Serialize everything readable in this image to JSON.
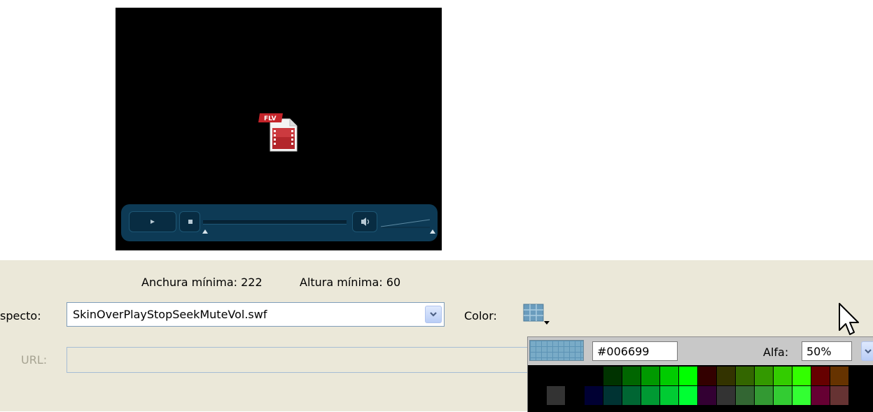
{
  "panel": {
    "min_width": "Anchura mínima: 222",
    "min_height": "Altura mínima: 60",
    "skin_label": "specto:",
    "skin_value": "SkinOverPlayStopSeekMuteVol.swf",
    "color_label": "Color:",
    "url_label": "URL:",
    "url_value": ""
  },
  "preview": {
    "badge_text": "FLV"
  },
  "picker": {
    "hex_value": "#006699",
    "alpha_label": "Alfa:",
    "alpha_value": "50%",
    "swatch_rows": [
      [
        "#000000",
        "#000000",
        "#000000",
        "#000000",
        "#003300",
        "#006600",
        "#009900",
        "#00cc00",
        "#00ff00",
        "#330000",
        "#333300",
        "#336600",
        "#339900",
        "#33cc00",
        "#33ff00",
        "#660000",
        "#663300"
      ],
      [
        "#000000",
        "#333333",
        "#000000",
        "#000033",
        "#003333",
        "#006633",
        "#009933",
        "#00cc33",
        "#00ff33",
        "#330033",
        "#333333",
        "#336633",
        "#339933",
        "#33cc33",
        "#33ff33",
        "#660033",
        "#663333"
      ]
    ]
  },
  "colors": {
    "panel_bg": "#ebe8d9",
    "skin_bar": "#0d3a55",
    "accent_blue": "#006699"
  }
}
